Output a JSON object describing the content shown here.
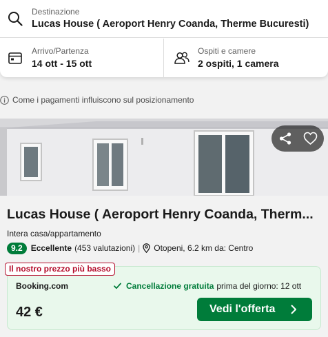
{
  "search": {
    "destination_label": "Destinazione",
    "destination_value": "Lucas House ( Aeroport Henry Coanda, Therme Bucuresti)",
    "dates_label": "Arrivo/Partenza",
    "dates_value": "14 ott - 15 ott",
    "guests_label": "Ospiti e camere",
    "guests_value": "2 ospiti, 1 camera"
  },
  "info_text": "Come i pagamenti influiscono sul posizionamento",
  "listing": {
    "title": "Lucas House ( Aeroport Henry Coanda, Therm...",
    "type": "Intera casa/appartamento",
    "score": "9.2",
    "rating_word": "Eccellente",
    "rating_count": "(453 valutazioni)",
    "separator": "|",
    "location": "Otopeni, 6.2 km da: Centro"
  },
  "offer": {
    "badge": "Il nostro prezzo più basso",
    "provider": "Booking.com",
    "cancellation": "Cancellazione gratuita",
    "cancellation_until": "prima del giorno: 12 ott",
    "price": "42 €",
    "cta_label": "Vedi l'offerta"
  },
  "colors": {
    "accent_green": "#007c3a",
    "badge_red": "#b40d2c",
    "offer_bg": "#e9f8ec"
  },
  "icons": {
    "destination": "search-icon",
    "dates": "calendar-icon",
    "guests": "users-icon",
    "info": "info-icon",
    "share": "share-icon",
    "favorite": "heart-icon",
    "location": "map-pin-icon",
    "cancellation": "check-icon",
    "cta": "chevron-right-icon"
  }
}
